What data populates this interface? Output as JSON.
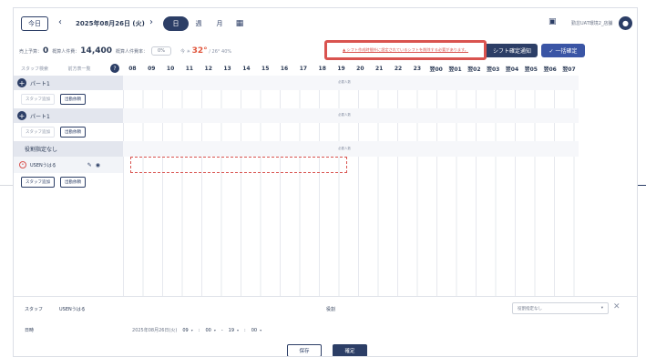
{
  "header": {
    "today": "今日",
    "date": "2025年08月26日 (火)",
    "views": [
      "日",
      "週",
      "月"
    ],
    "user": "勤怠UAT環境2_店舗"
  },
  "stats": {
    "sales_label": "売上予算：",
    "sales_value": "0",
    "staff_cost_label": "概算人件費：",
    "staff_cost_value": "14,400",
    "rate_label": "概算人件費率：",
    "rate_value": "0%",
    "weather_prefix": "今 ☀",
    "temp_high": "32°",
    "temp_rest": "/ 26° 40%"
  },
  "alert": {
    "text": "▲ シフト作成時間外に設定されているシフトを削除する必要があります。"
  },
  "actions": {
    "notify": "シフト確定通知",
    "confirm": "✓ 一括確定"
  },
  "left": {
    "staff_placeholder": "スタッフ検索",
    "list_label": "前方表一覧",
    "groups": [
      {
        "name": "パート1",
        "add_staff": "スタッフ追加",
        "bulk": "出勤依頼"
      },
      {
        "name": "パート1",
        "add_staff": "スタッフ追加",
        "bulk": "出勤依頼"
      }
    ],
    "no_position": "役割指定なし",
    "staff_name": "USENうはる",
    "staff_add": "スタッフ追加",
    "staff_bulk": "出勤依頼"
  },
  "hours": [
    "08",
    "09",
    "10",
    "11",
    "12",
    "13",
    "14",
    "15",
    "16",
    "17",
    "18",
    "19",
    "20",
    "21",
    "22",
    "23",
    "翌00",
    "翌01",
    "翌02",
    "翌03",
    "翌04",
    "翌05",
    "翌06",
    "翌07"
  ],
  "required_label": "必要人数",
  "panel": {
    "staff_label": "スタッフ",
    "staff_value": "USENうはる",
    "position_label": "役割",
    "position_value": "役割指定なし",
    "date_label": "日時",
    "date_value": "2025年08月26日(火)",
    "start_hour": "09",
    "start_min": "00",
    "end_hour": "19",
    "end_min": "00",
    "save": "保存",
    "fix": "確定"
  }
}
